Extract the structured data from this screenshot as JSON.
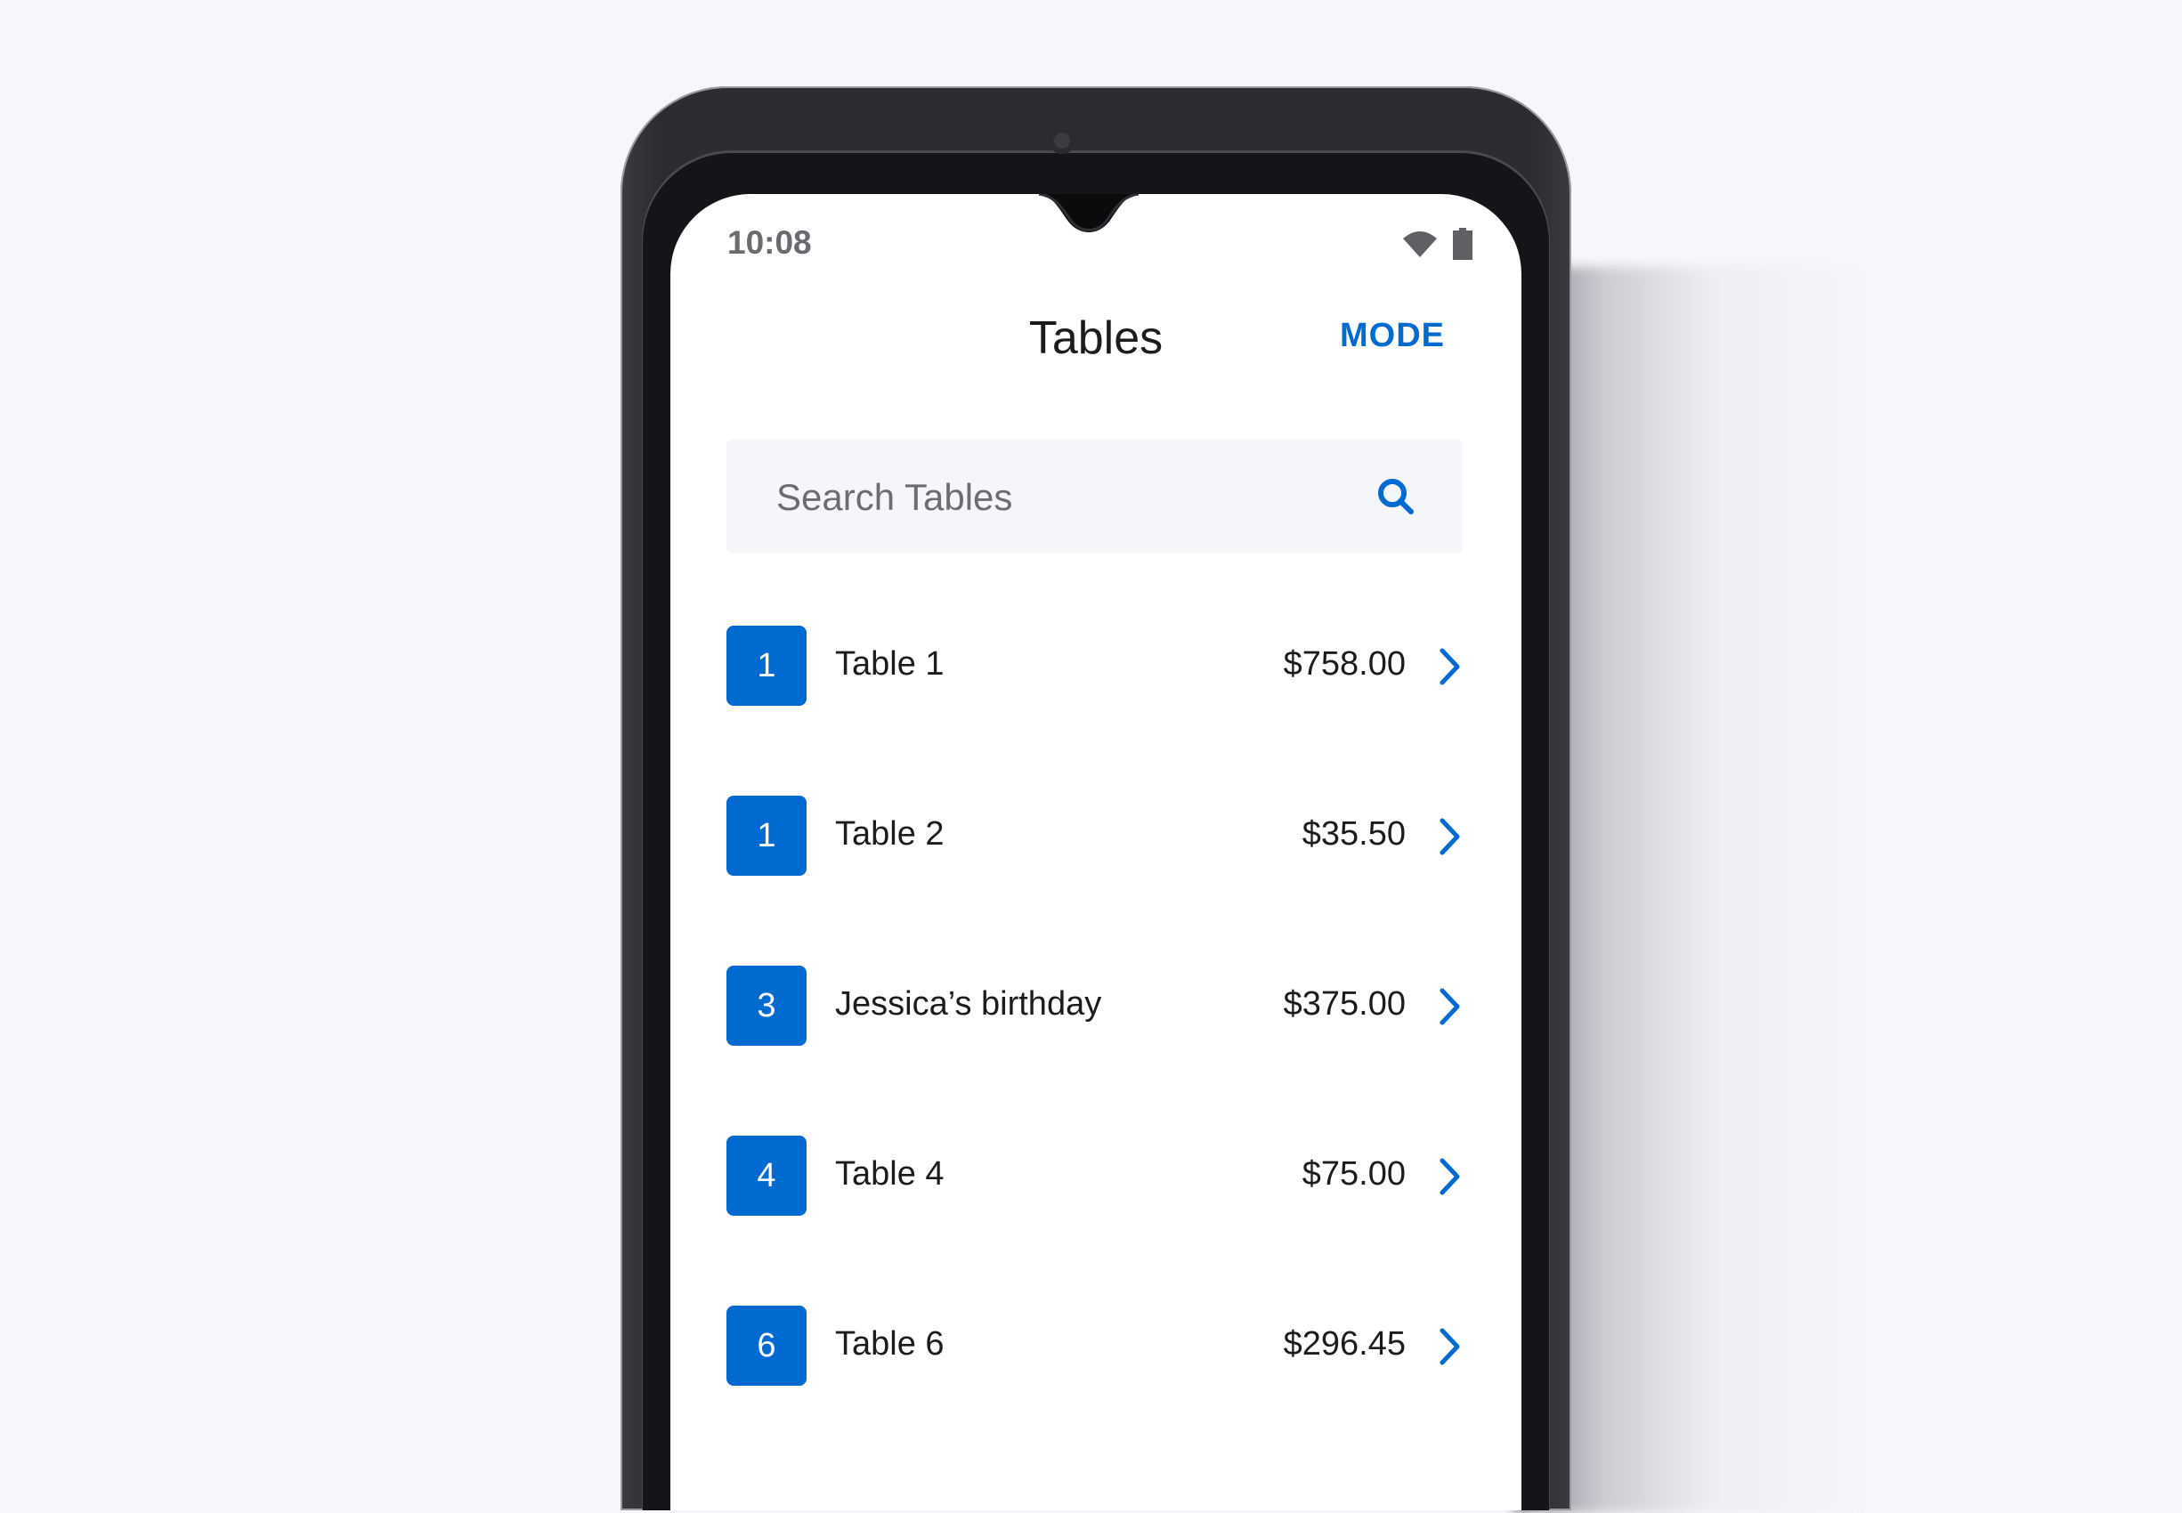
{
  "status_bar": {
    "time": "10:08",
    "icons": [
      "wifi-icon",
      "battery-icon"
    ]
  },
  "header": {
    "title": "Tables",
    "mode_label": "MODE"
  },
  "search": {
    "placeholder": "Search Tables",
    "value": "",
    "icon": "search-icon"
  },
  "tables": [
    {
      "badge": "1",
      "name": "Table 1",
      "amount": "$758.00"
    },
    {
      "badge": "1",
      "name": "Table 2",
      "amount": "$35.50"
    },
    {
      "badge": "3",
      "name": "Jessica’s birthday",
      "amount": "$375.00"
    },
    {
      "badge": "4",
      "name": "Table 4",
      "amount": "$75.00"
    },
    {
      "badge": "6",
      "name": "Table 6",
      "amount": "$296.45"
    }
  ],
  "colors": {
    "accent": "#006ad0",
    "text": "#1c1c1e",
    "muted": "#6c6d72",
    "search_bg": "#f5f6f9",
    "page_bg": "#f6f7fa"
  }
}
